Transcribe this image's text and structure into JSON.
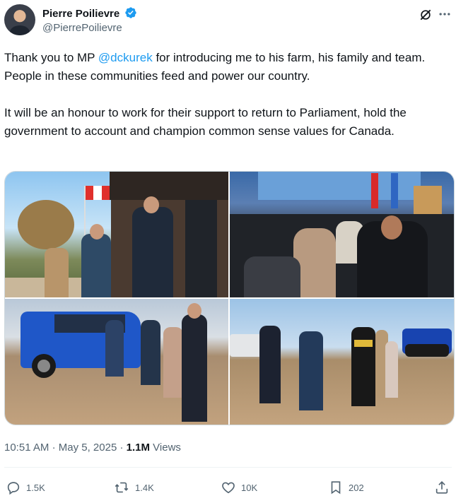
{
  "author": {
    "name": "Pierre Poilievre",
    "handle": "@PierrePoilievre",
    "verified_icon": "verified-badge-icon",
    "colors": {
      "verified": "#1d9bf0"
    }
  },
  "tweet": {
    "line1_before": "Thank you to MP ",
    "mention": "@dckurek",
    "line1_after": " for introducing me to his farm, his family and team. People in these communities feed and power our country.",
    "paragraph2": "It will be an honour to work for their support to return to Parliament, hold the government to account and champion common sense values for Canada."
  },
  "media": {
    "photos": [
      {
        "scene": "handshake-at-house-door"
      },
      {
        "scene": "crowded-room-gathering"
      },
      {
        "scene": "group-by-blue-truck"
      },
      {
        "scene": "handshake-in-field-with-tractor"
      }
    ]
  },
  "meta": {
    "time": "10:51 AM",
    "separator": "·",
    "date": "May 5, 2025",
    "views_count": "1.1M",
    "views_label": "Views"
  },
  "actions": {
    "replies": "1.5K",
    "reposts": "1.4K",
    "likes": "10K",
    "bookmarks": "202"
  },
  "colors": {
    "text": "#0f1419",
    "secondary": "#536471",
    "link": "#1d9bf0",
    "border": "#cfd9de"
  }
}
